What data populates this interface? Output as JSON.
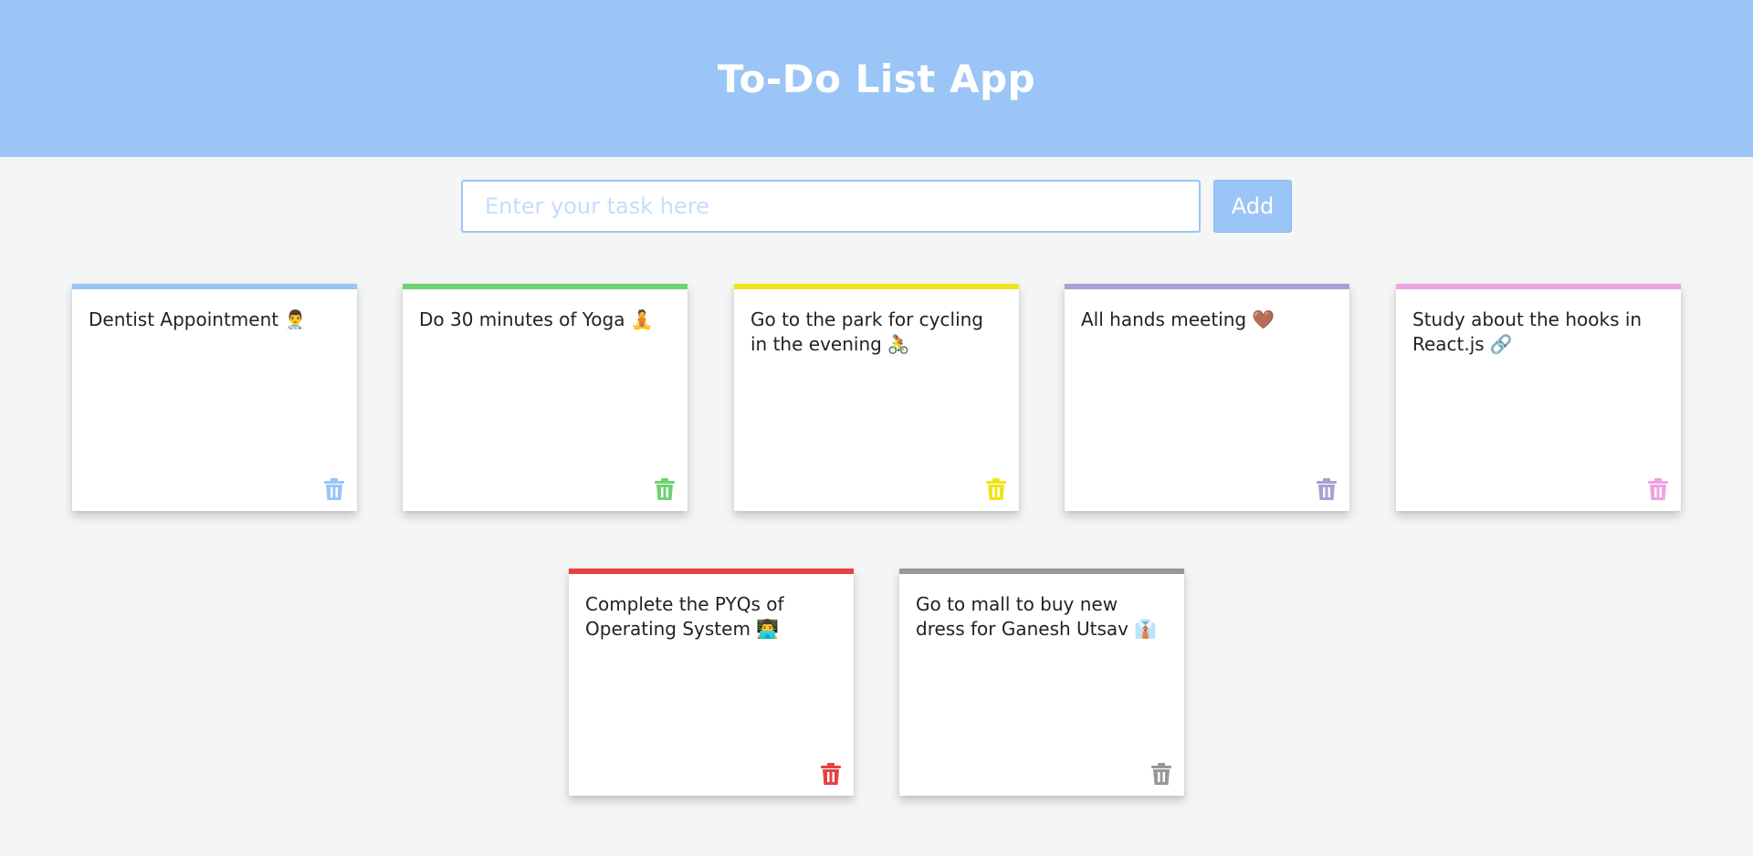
{
  "header": {
    "title": "To-Do List App"
  },
  "input": {
    "placeholder": "Enter your task here",
    "value": ""
  },
  "add_button": {
    "label": "Add"
  },
  "tasks": [
    {
      "text": "Dentist Appointment",
      "emoji": "👨‍⚕️",
      "color": "#9ac5f6"
    },
    {
      "text": "Do 30 minutes of Yoga",
      "emoji": "🧘",
      "color": "#6fd274"
    },
    {
      "text": "Go to the park for cycling in the evening",
      "emoji": "🚴",
      "color": "#f0e41c"
    },
    {
      "text": "All hands meeting",
      "emoji": "🤎",
      "color": "#a7a1d3"
    },
    {
      "text": "Study about the hooks in React.js",
      "emoji": "🔗",
      "color": "#eea3e0"
    },
    {
      "text": "Complete the PYQs of Operating System",
      "emoji": "👨‍💻",
      "color": "#e94040"
    },
    {
      "text": "Go to mall to buy new dress for Ganesh Utsav",
      "emoji": "👔",
      "color": "#9a9797"
    }
  ],
  "icons": {
    "delete": "trash-icon"
  }
}
